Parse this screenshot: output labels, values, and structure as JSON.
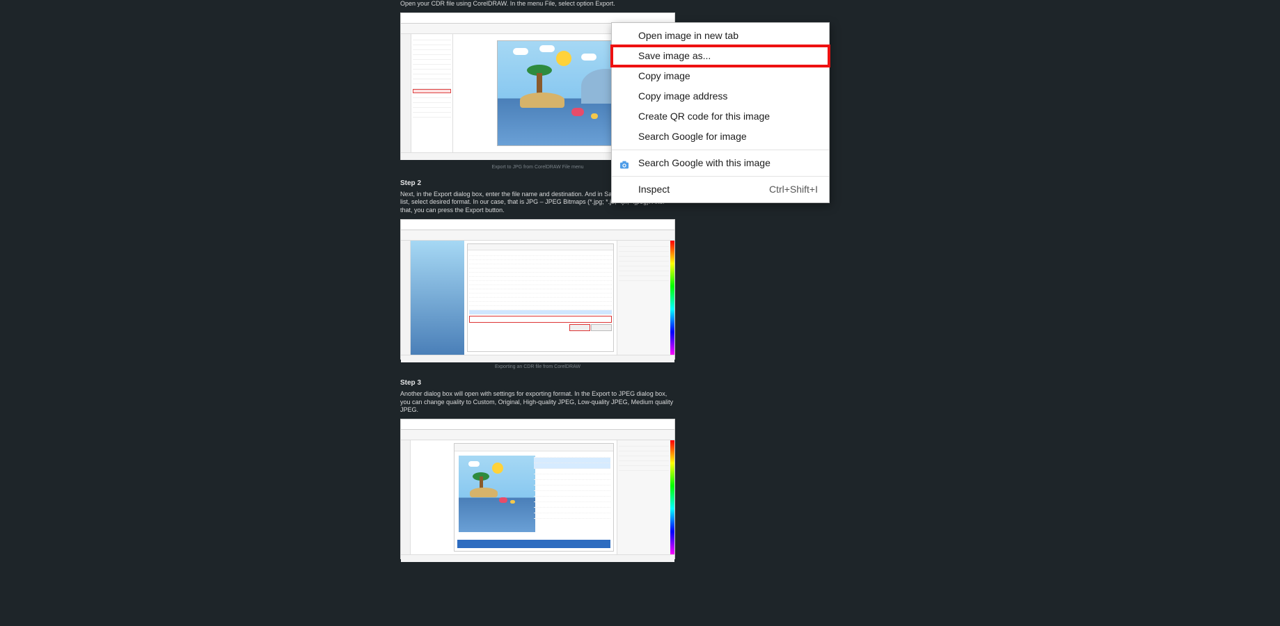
{
  "article": {
    "step1_text": "Open your CDR file using CorelDRAW. In the menu File, select option Export.",
    "caption1": "Export to JPG from CorelDRAW File menu",
    "step2_title": "Step 2",
    "step2_text": "Next, in the Export dialog box, enter the file name and destination. And in Save as type drop-down list, select desired format. In our case, that is JPG – JPEG Bitmaps (*.jpg; *.jtf; *.jff; *.jpeg). After that, you can press the Export button.",
    "caption2": "Exporting an CDR file from CorelDRAW",
    "step3_title": "Step 3",
    "step3_text": "Another dialog box will open with settings for exporting format. In the Export to JPEG dialog box, you can change quality to Custom, Original, High-quality JPEG, Low-quality JPEG, Medium quality JPEG."
  },
  "context_menu": {
    "items": [
      {
        "label": "Open image in new tab"
      },
      {
        "label": "Save image as...",
        "highlighted": true
      },
      {
        "label": "Copy image"
      },
      {
        "label": "Copy image address"
      },
      {
        "label": "Create QR code for this image"
      },
      {
        "label": "Search Google for image"
      }
    ],
    "camera_item": {
      "label": "Search Google with this image"
    },
    "inspect": {
      "label": "Inspect",
      "shortcut": "Ctrl+Shift+I"
    }
  }
}
